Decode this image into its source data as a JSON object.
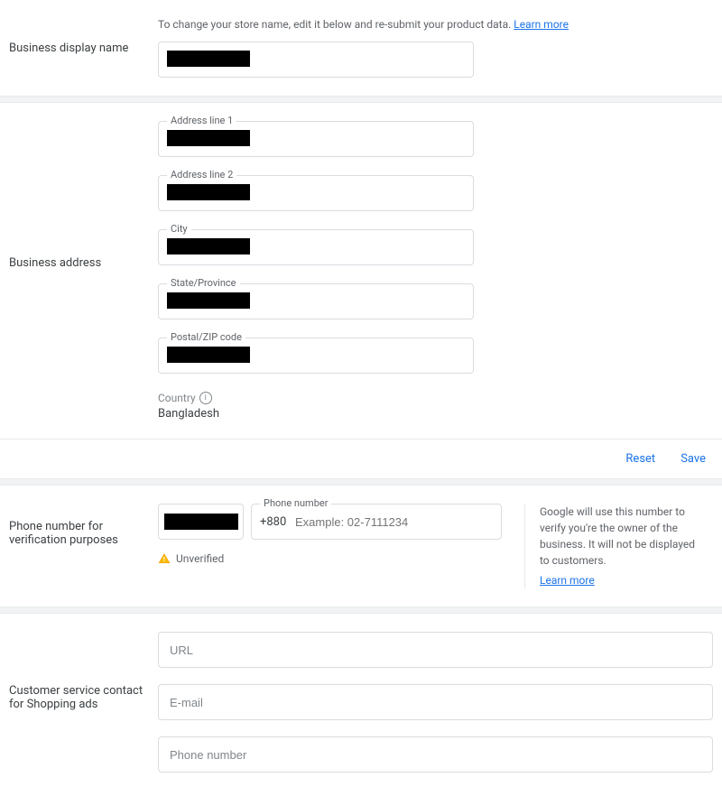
{
  "displayName": {
    "helper": "To change your store name, edit it below and re-submit your product data. ",
    "learnMore": "Learn more",
    "label": "Business display name"
  },
  "address": {
    "label": "Business address",
    "line1Label": "Address line 1",
    "line2Label": "Address line 2",
    "cityLabel": "City",
    "stateLabel": "State/Province",
    "postalLabel": "Postal/ZIP code",
    "countryLabel": "Country",
    "countryValue": "Bangladesh"
  },
  "actions": {
    "reset": "Reset",
    "save": "Save"
  },
  "phone": {
    "label": "Phone number for verification purposes",
    "fieldLabel": "Phone number",
    "prefix": "+880",
    "placeholder": "Example: 02-7111234",
    "status": "Unverified",
    "info": "Google will use this number to verify you're the owner of the business. It will not be displayed to customers.",
    "learnMore": "Learn more"
  },
  "customerService": {
    "label": "Customer service contact for Shopping ads",
    "urlPlaceholder": "URL",
    "emailPlaceholder": "E-mail",
    "phonePlaceholder": "Phone number"
  }
}
